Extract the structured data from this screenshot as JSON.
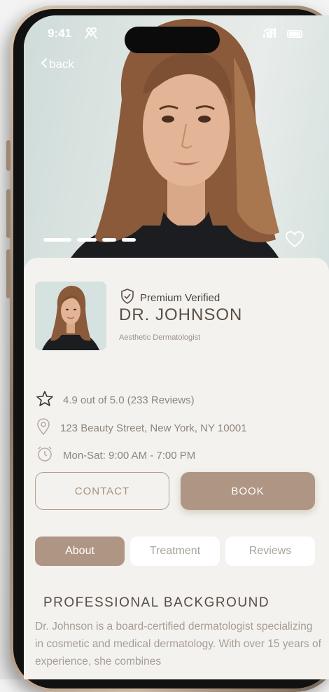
{
  "status_bar": {
    "time": "9:41"
  },
  "nav": {
    "back_label": "back"
  },
  "hero": {
    "carousel_count": 4,
    "active_index": 0
  },
  "profile": {
    "badge": "Premium Verified",
    "name": "DR. JOHNSON",
    "specialty": "Aesthetic Dermatologist"
  },
  "details": {
    "rating": "4.9 out of 5.0 (233 Reviews)",
    "address": "123 Beauty Street, New York, NY 10001",
    "hours": "Mon-Sat: 9:00 AM - 7:00 PM"
  },
  "actions": {
    "contact_label": "CONTACT",
    "book_label": "BOOK"
  },
  "tabs": [
    {
      "label": "About",
      "active": true
    },
    {
      "label": "Treatment",
      "active": false
    },
    {
      "label": "Reviews",
      "active": false
    }
  ],
  "about": {
    "section_title": "PROFESSIONAL BACKGROUND",
    "text": "Dr. Johnson is a board-certified dermatologist specializing in cosmetic and medical dermatology. With over 15 years of experience, she combines"
  },
  "colors": {
    "accent": "#af9584",
    "background": "#f4f2ef",
    "text_muted": "#8e857c"
  },
  "icons": [
    "back-chevron-icon",
    "people-icon",
    "heart-icon",
    "shield-check-icon",
    "star-icon",
    "location-pin-icon",
    "clock-icon"
  ]
}
